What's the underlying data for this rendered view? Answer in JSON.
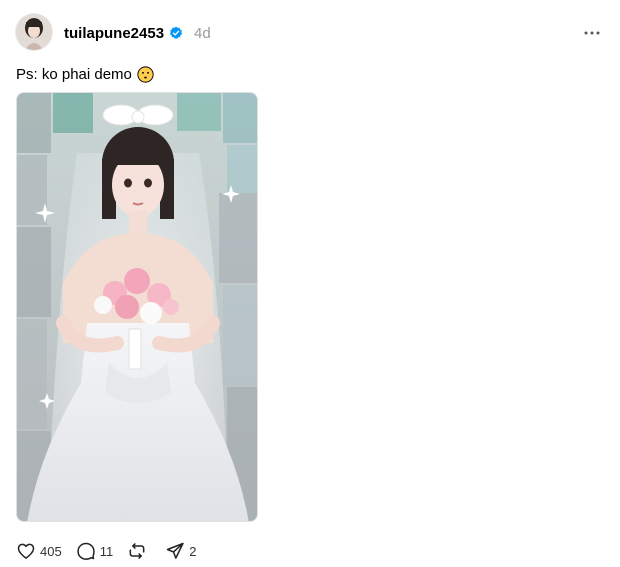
{
  "post": {
    "username": "tuilapune2453",
    "verified": true,
    "timestamp": "4d",
    "caption": "Ps: ko phai demo",
    "caption_emoji": "flushed-face-emoji",
    "more_icon": "more-horizontal-icon"
  },
  "actions": {
    "likes": "405",
    "comments": "11",
    "reposts": "",
    "shares": "2"
  },
  "colors": {
    "verified_blue": "#0095F6",
    "timestamp_gray": "#999999",
    "emoji_yellow": "#FFCC4D"
  }
}
